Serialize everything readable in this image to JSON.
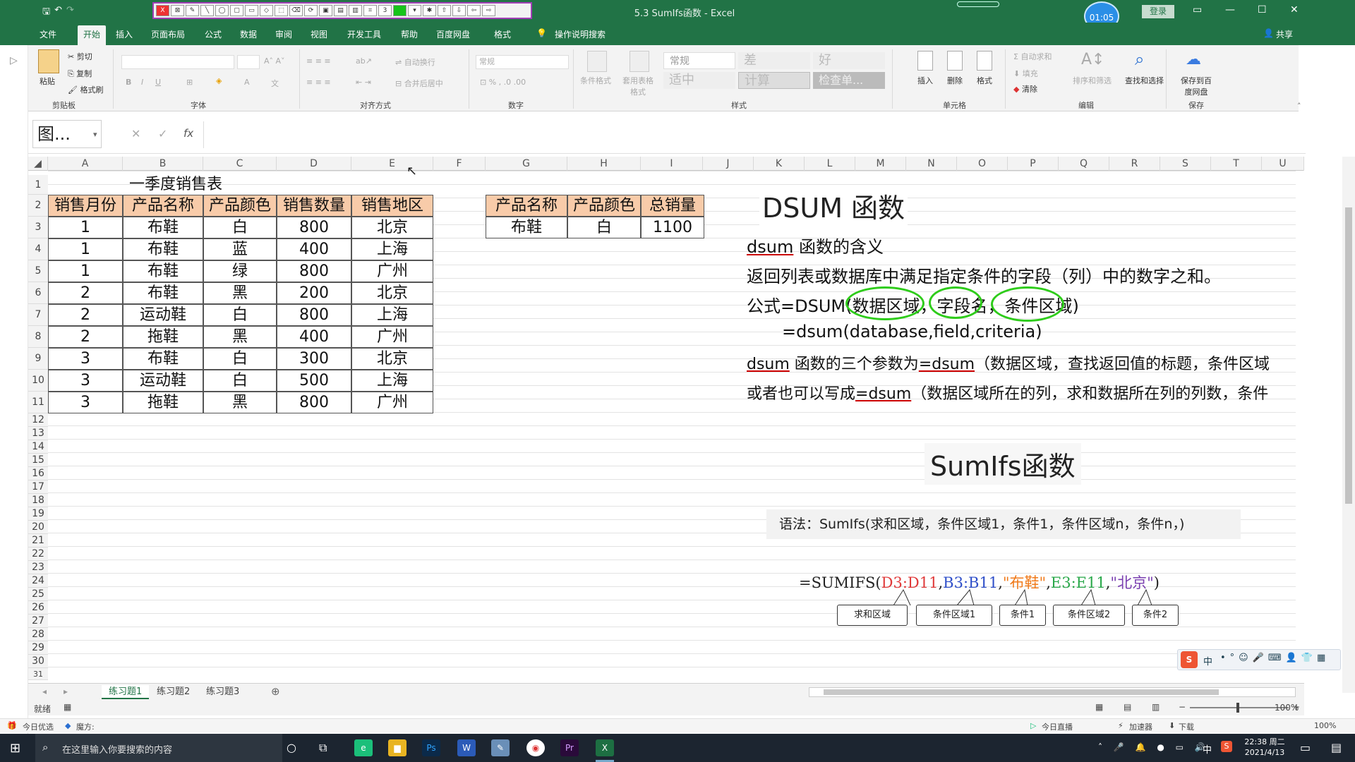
{
  "window": {
    "title": "5.3 SumIfs函数 - Excel",
    "timer": "01:05",
    "login_label": "登录",
    "share_label": "共享"
  },
  "tabs": [
    "文件",
    "开始",
    "插入",
    "页面布局",
    "公式",
    "数据",
    "审阅",
    "视图",
    "开发工具",
    "帮助",
    "百度网盘",
    "格式"
  ],
  "tell_me": "操作说明搜索",
  "ribbon": {
    "clipboard": {
      "paste": "粘贴",
      "cut": "剪切",
      "copy": "复制",
      "format_painter": "格式刷",
      "group": "剪贴板"
    },
    "font": {
      "group": "字体"
    },
    "alignment": {
      "wrap": "自动换行",
      "merge": "合并后居中",
      "group": "对齐方式"
    },
    "number": {
      "format": "常规",
      "group": "数字"
    },
    "styles": {
      "cond_format": "条件格式",
      "table_format": "套用表格格式",
      "normal": "常规",
      "bad": "差",
      "good": "好",
      "neutral": "适中",
      "calc": "计算",
      "check": "检查单...",
      "group": "样式"
    },
    "cells": {
      "insert": "插入",
      "delete": "删除",
      "format": "格式",
      "group": "单元格"
    },
    "editing": {
      "autosum": "自动求和",
      "fill": "填充",
      "clear": "清除",
      "sort": "排序和筛选",
      "find": "查找和选择",
      "group": "编辑"
    },
    "save": {
      "save_baidu": "保存到百度网盘",
      "group": "保存"
    }
  },
  "formula_bar": {
    "name_box": "图...",
    "formula": ""
  },
  "columns": [
    "A",
    "B",
    "C",
    "D",
    "E",
    "F",
    "G",
    "H",
    "I",
    "J",
    "K",
    "L",
    "M",
    "N",
    "O",
    "P",
    "Q",
    "R",
    "S",
    "T",
    "U"
  ],
  "rows": [
    "1",
    "2",
    "3",
    "4",
    "5",
    "6",
    "7",
    "8",
    "9",
    "10",
    "11",
    "12",
    "13",
    "14",
    "15",
    "16",
    "17",
    "18",
    "19",
    "20",
    "21",
    "22",
    "23",
    "24",
    "25",
    "26",
    "27",
    "28",
    "29",
    "30",
    "31"
  ],
  "sheet": {
    "title": "一季度销售表",
    "headers": [
      "销售月份",
      "产品名称",
      "产品颜色",
      "销售数量",
      "销售地区"
    ],
    "rows": [
      [
        "1",
        "布鞋",
        "白",
        "800",
        "北京"
      ],
      [
        "1",
        "布鞋",
        "蓝",
        "400",
        "上海"
      ],
      [
        "1",
        "布鞋",
        "绿",
        "800",
        "广州"
      ],
      [
        "2",
        "布鞋",
        "黑",
        "200",
        "北京"
      ],
      [
        "2",
        "运动鞋",
        "白",
        "800",
        "上海"
      ],
      [
        "2",
        "拖鞋",
        "黑",
        "400",
        "广州"
      ],
      [
        "3",
        "布鞋",
        "白",
        "300",
        "北京"
      ],
      [
        "3",
        "运动鞋",
        "白",
        "500",
        "上海"
      ],
      [
        "3",
        "拖鞋",
        "黑",
        "800",
        "广州"
      ]
    ],
    "criteria_headers": [
      "产品名称",
      "产品颜色",
      "总销量"
    ],
    "criteria_row": [
      "布鞋",
      "白",
      "1100"
    ]
  },
  "notes": {
    "dsum_title": "DSUM 函数",
    "line1_a": "dsum",
    "line1_b": " 函数的含义",
    "line2": "返回列表或数据库中满足指定条件的字段（列）中的数字之和。",
    "line3_prefix": "公式=DSUM(",
    "line3_arg1": "数据区域",
    "line3_arg2": "字段名",
    "line3_arg3": "条件区域",
    "line3_suffix": ")",
    "line4": "=dsum(database,field,criteria)",
    "line5_a": "dsum",
    "line5_b": " 函数的三个参数为",
    "line5_c": "=dsum",
    "line5_d": "（数据区域，查找返回值的标题，条件区域",
    "line6_a": "或者也可以写成",
    "line6_b": "=dsum",
    "line6_c": "（数据区域所在的列，求和数据所在列的列数，条件",
    "sumifs_title": "SumIfs函数",
    "syntax": "语法：SumIfs(求和区域，条件区域1，条件1，条件区域n，条件n，)",
    "formula_parts": {
      "p0": "=SUMIFS(",
      "p1": "D3:D11",
      "c1": ",",
      "p2": "B3:B11",
      "c2": ",",
      "p3": "\"布鞋\"",
      "c3": ",",
      "p4": "E3:E11",
      "c4": ",",
      "p5": "\"北京\"",
      "p6": ")"
    },
    "formula_colors": {
      "p1": "#e03a3a",
      "p2": "#2f4fc9",
      "p3": "#f07a1a",
      "p4": "#2aa84a",
      "p5": "#7a3fb0"
    },
    "labels": [
      "求和区域",
      "条件区域1",
      "条件1",
      "条件区域2",
      "条件2"
    ]
  },
  "sheet_tabs": [
    "练习题1",
    "练习题2",
    "练习题3"
  ],
  "status": {
    "ready": "就绪",
    "zoom": "100%"
  },
  "status2": {
    "left1": "今日优选",
    "left2": "魔方:",
    "live": "今日直播",
    "speed": "加速器",
    "download": "下载",
    "zoom": "100%"
  },
  "taskbar": {
    "search": "在这里输入你要搜索的内容",
    "time": "22:38 周二",
    "date": "2021/4/13",
    "ime": "中"
  },
  "colors": {
    "excel_green": "#217346",
    "header_fill": "#f8cba9",
    "circle": "#2ecc1a"
  }
}
